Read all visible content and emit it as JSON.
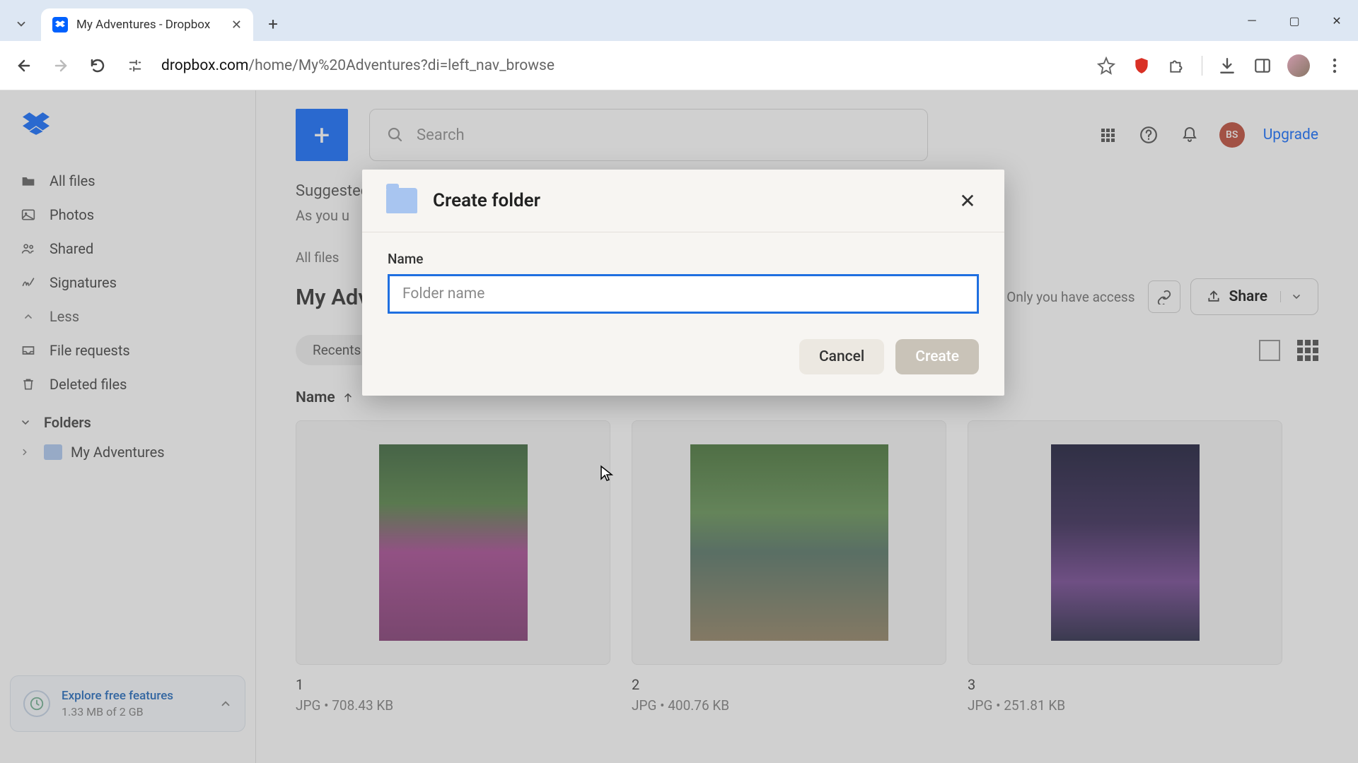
{
  "browser": {
    "tab_title": "My Adventures - Dropbox",
    "url_domain": "dropbox.com",
    "url_path": "/home/My%20Adventures?di=left_nav_browse"
  },
  "sidebar": {
    "items": [
      {
        "label": "All files"
      },
      {
        "label": "Photos"
      },
      {
        "label": "Shared"
      },
      {
        "label": "Signatures"
      },
      {
        "label": "Less"
      },
      {
        "label": "File requests"
      },
      {
        "label": "Deleted files"
      }
    ],
    "folders_label": "Folders",
    "folder_name": "My Adventures",
    "quota": {
      "title": "Explore free features",
      "usage": "1.33 MB of 2 GB"
    }
  },
  "header": {
    "search_placeholder": "Search",
    "avatar_initials": "BS",
    "upgrade": "Upgrade"
  },
  "content": {
    "suggested_label": "Suggested",
    "suggested_sub": "As you u",
    "breadcrumb": "All files",
    "title": "My Adventures",
    "access_text": "Only you have access",
    "share_label": "Share",
    "filter_pill": "Recents",
    "col_name": "Name",
    "items": [
      {
        "name": "1",
        "meta": "JPG • 708.43 KB"
      },
      {
        "name": "2",
        "meta": "JPG • 400.76 KB"
      },
      {
        "name": "3",
        "meta": "JPG • 251.81 KB"
      }
    ]
  },
  "modal": {
    "title": "Create folder",
    "field_label": "Name",
    "placeholder": "Folder name",
    "cancel": "Cancel",
    "create": "Create"
  }
}
